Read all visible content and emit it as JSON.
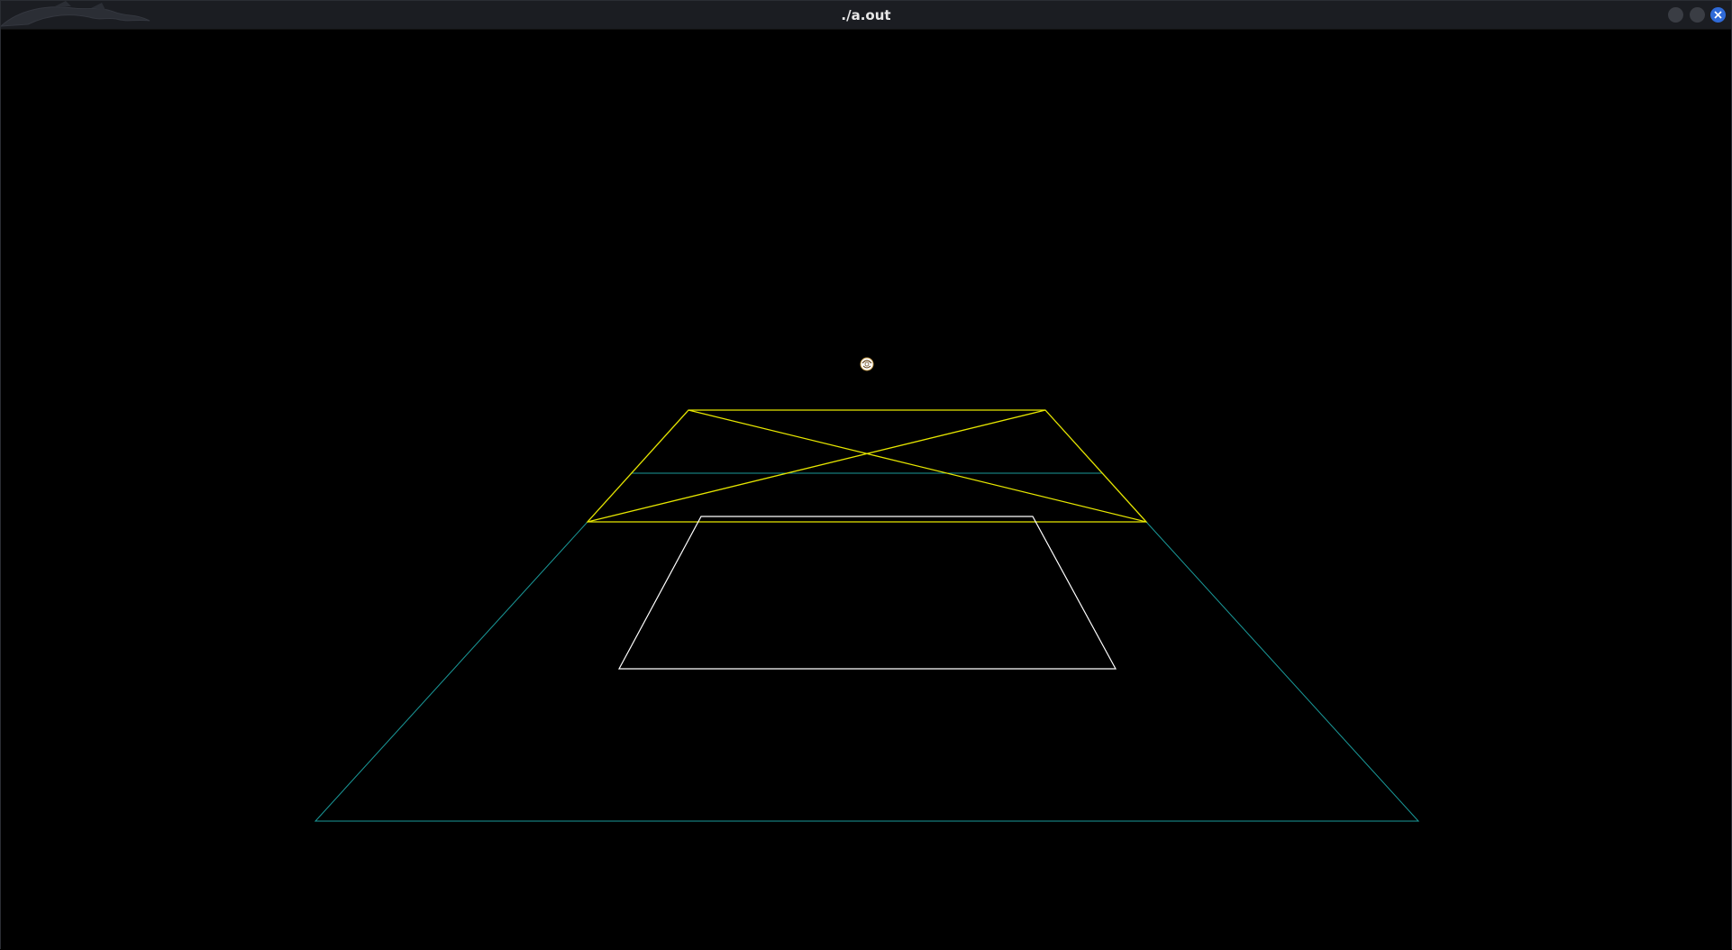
{
  "window": {
    "title": "./a.out",
    "minimize_icon": "minimize-icon",
    "maximize_icon": "maximize-icon",
    "close_icon": "close-icon",
    "logo_icon": "dragon-logo-icon"
  },
  "colors": {
    "titlebar_bg": "#1b1d22",
    "canvas_bg": "#000000",
    "floor_outline": "#1a9a9a",
    "upper_quad": "#e6e600",
    "inner_rect": "#ffffff",
    "close_button": "#2f6ad8",
    "ball": "#ffffff"
  },
  "scene": {
    "objects": [
      "floor-outline",
      "upper-quad-with-diagonals",
      "inner-white-quad",
      "ball-icon"
    ]
  }
}
